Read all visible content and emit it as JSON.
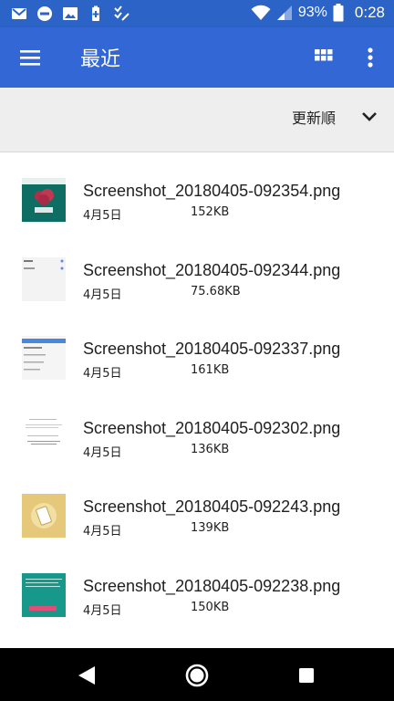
{
  "status_bar": {
    "battery_percent": "93%",
    "time": "0:28",
    "left_icons": [
      "gmail-icon",
      "do-not-disturb-icon",
      "photo-icon",
      "battery-saver-icon",
      "checklist-icon"
    ],
    "right_icons": [
      "wifi-icon",
      "signal-icon",
      "battery-icon"
    ]
  },
  "app_bar": {
    "title": "最近",
    "color": "#3367d6"
  },
  "sort": {
    "label": "更新順"
  },
  "files": [
    {
      "name": "Screenshot_20180405-092354.png",
      "date": "4月5日",
      "size": "152KB",
      "thumb": "teal-pink"
    },
    {
      "name": "Screenshot_20180405-092344.png",
      "date": "4月5日",
      "size": "75.68KB",
      "thumb": "light-list"
    },
    {
      "name": "Screenshot_20180405-092337.png",
      "date": "4月5日",
      "size": "161KB",
      "thumb": "blue-form"
    },
    {
      "name": "Screenshot_20180405-092302.png",
      "date": "4月5日",
      "size": "136KB",
      "thumb": "white-text"
    },
    {
      "name": "Screenshot_20180405-092243.png",
      "date": "4月5日",
      "size": "139KB",
      "thumb": "yellow-phone"
    },
    {
      "name": "Screenshot_20180405-092238.png",
      "date": "4月5日",
      "size": "150KB",
      "thumb": "teal-button"
    }
  ]
}
